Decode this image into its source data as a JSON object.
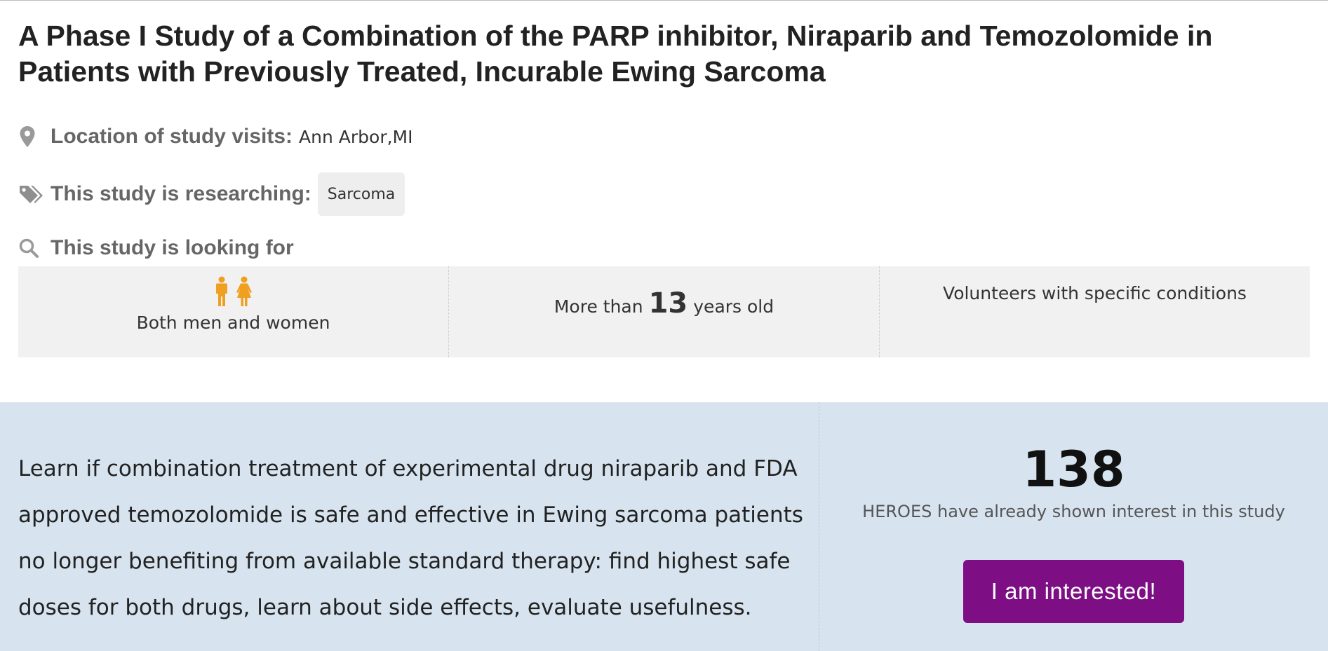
{
  "study": {
    "title": "A Phase I Study of a Combination of the PARP inhibitor, Niraparib and Temozolomide in Patients with Previously Treated, Incurable Ewing Sarcoma"
  },
  "location": {
    "icon": "map-pin-icon",
    "label": "Location of study visits:",
    "value": "Ann Arbor,MI"
  },
  "researching": {
    "icon": "tags-icon",
    "label": "This study is researching:",
    "tag": "Sarcoma"
  },
  "looking_for": {
    "icon": "search-icon",
    "label": "This study is looking for",
    "gender": {
      "icons": [
        "male-icon",
        "female-icon"
      ],
      "text": "Both men and women"
    },
    "age": {
      "prefix": "More than",
      "number": "13",
      "suffix": "years old"
    },
    "volunteers": "Volunteers with specific conditions"
  },
  "summary": "Learn if combination treatment of experimental drug niraparib and FDA approved temozolomide is safe and effective in Ewing sarcoma patients no longer benefiting from available standard therapy: find highest safe doses for both drugs, learn about side effects, evaluate usefulness.",
  "interest": {
    "count": "138",
    "caption": "HEROES have already shown interest in this study",
    "button_label": "I am interested!"
  },
  "colors": {
    "accent_button": "#7d0e84",
    "gender_icon": "#f0a020",
    "band_background": "#d7e4ef",
    "criteria_background": "#f1f1f1"
  }
}
